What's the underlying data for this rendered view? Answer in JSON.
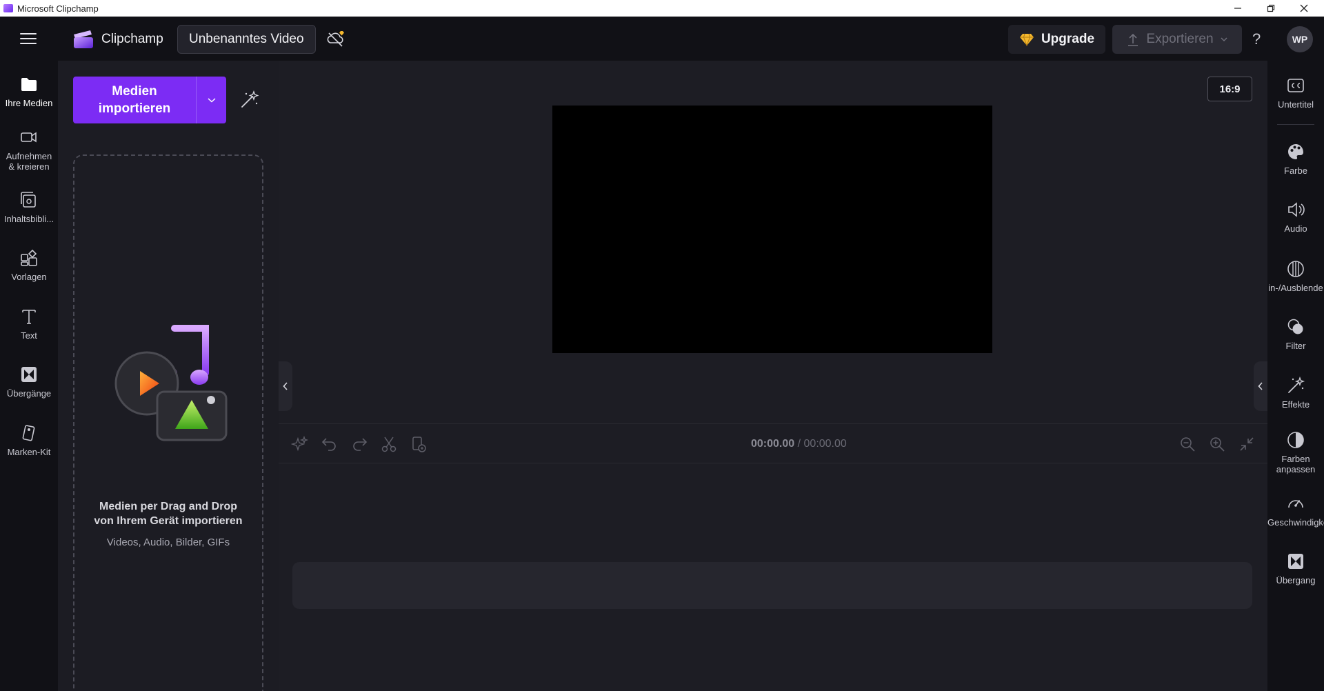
{
  "window": {
    "title": "Microsoft Clipchamp",
    "controls": {
      "minimize": "—",
      "restore": "❐",
      "close": "✕"
    }
  },
  "header": {
    "brand": "Clipchamp",
    "project_title": "Unbenanntes Video",
    "upgrade_label": "Upgrade",
    "export_label": "Exportieren",
    "help": "?",
    "avatar_initials": "WP",
    "accent": "#7c2cf4"
  },
  "left_nav": {
    "items": [
      {
        "label": "Ihre Medien",
        "icon": "folder-icon",
        "active": true
      },
      {
        "label": "Aufnehmen\n& kreieren",
        "icon": "camera-icon"
      },
      {
        "label": "Inhaltsbibli...",
        "icon": "library-icon"
      },
      {
        "label": "Vorlagen",
        "icon": "templates-icon"
      },
      {
        "label": "Text",
        "icon": "text-icon"
      },
      {
        "label": "Übergänge",
        "icon": "transitions-icon"
      },
      {
        "label": "Marken-Kit",
        "icon": "brand-kit-icon"
      }
    ]
  },
  "media_panel": {
    "import_label": "Medien\nimportieren",
    "drop_title": "Medien per Drag and Drop\nvon Ihrem Gerät importieren",
    "drop_subtitle": "Videos, Audio, Bilder, GIFs"
  },
  "preview": {
    "aspect_ratio": "16:9"
  },
  "timeline": {
    "current_time": "00:00.00",
    "separator": " / ",
    "duration": "00:00.00"
  },
  "right_panel": {
    "items": [
      {
        "label": "Untertitel",
        "icon": "captions-icon"
      },
      {
        "label": "Farbe",
        "icon": "palette-icon"
      },
      {
        "label": "Audio",
        "icon": "speaker-icon"
      },
      {
        "label": "in-/Ausblende",
        "icon": "fade-icon"
      },
      {
        "label": "Filter",
        "icon": "filter-icon"
      },
      {
        "label": "Effekte",
        "icon": "effects-wand-icon"
      },
      {
        "label": "Farben\nanpassen",
        "icon": "adjust-colors-icon"
      },
      {
        "label": "Geschwindigke",
        "icon": "speed-icon"
      },
      {
        "label": "Übergang",
        "icon": "transition-icon"
      }
    ]
  }
}
